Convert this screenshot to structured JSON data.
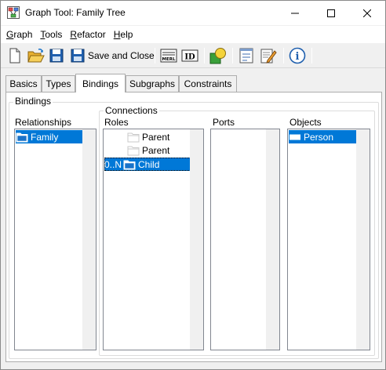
{
  "window": {
    "title": "Graph Tool: Family Tree"
  },
  "menu": [
    {
      "label_pre": "",
      "mnemonic": "G",
      "label_post": "raph"
    },
    {
      "label_pre": "",
      "mnemonic": "T",
      "label_post": "ools"
    },
    {
      "label_pre": "",
      "mnemonic": "R",
      "label_post": "efactor"
    },
    {
      "label_pre": "",
      "mnemonic": "H",
      "label_post": "elp"
    }
  ],
  "toolbar": {
    "save_close_label": "Save and Close",
    "merl_label": "MERL",
    "id_label": "ID",
    "info_label": "i"
  },
  "tabs": [
    "Basics",
    "Types",
    "Bindings",
    "Subgraphs",
    "Constraints"
  ],
  "active_tab": "Bindings",
  "bindings": {
    "group_label": "Bindings",
    "relationships_label": "Relationships",
    "relationships": [
      {
        "label": "Family",
        "selected": true
      }
    ],
    "connections_label": "Connections",
    "roles_label": "Roles",
    "roles": [
      {
        "multiplicity": "",
        "label": "Parent",
        "selected": false
      },
      {
        "multiplicity": "",
        "label": "Parent",
        "selected": false
      },
      {
        "multiplicity": "0..N",
        "label": "Child",
        "selected": true
      }
    ],
    "ports_label": "Ports",
    "ports": [],
    "objects_label": "Objects",
    "objects": [
      {
        "label": "Person",
        "selected": true
      }
    ]
  },
  "colors": {
    "selection": "#0078d7",
    "accent_folder": "#1a73c9"
  }
}
